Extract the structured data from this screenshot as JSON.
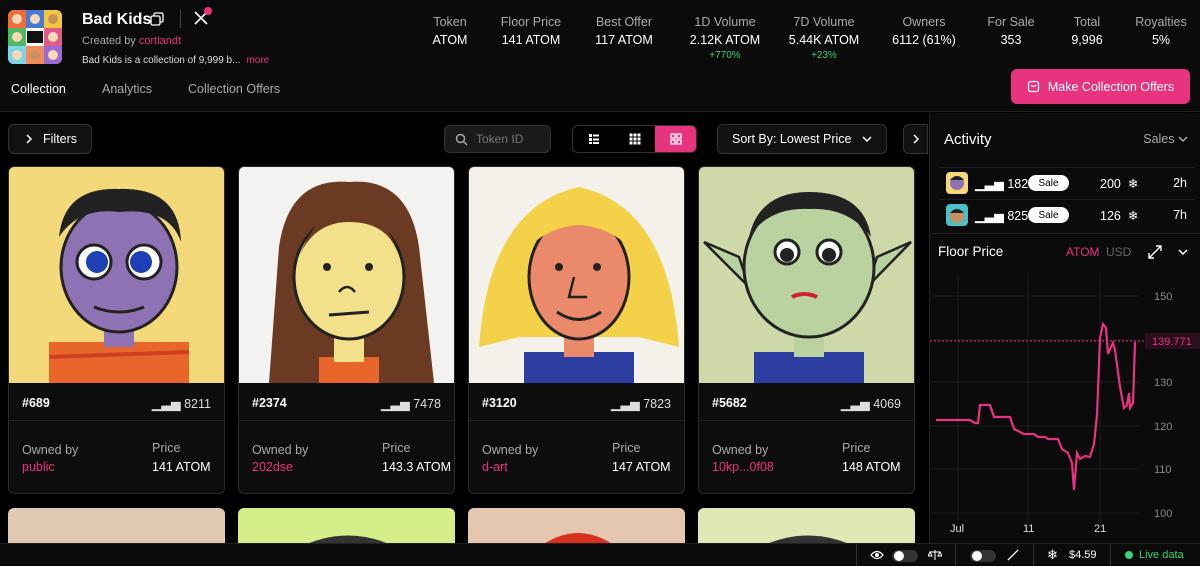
{
  "collection": {
    "name": "Bad Kids",
    "created_by_label": "Created by",
    "creator": "cortlandt",
    "description": "Bad Kids is a collection of 9,999 b...",
    "more_label": "more"
  },
  "stats": [
    {
      "label": "Token",
      "value": "ATOM",
      "change": ""
    },
    {
      "label": "Floor Price",
      "value": "141 ATOM",
      "change": ""
    },
    {
      "label": "Best Offer",
      "value": "117 ATOM",
      "change": ""
    },
    {
      "label": "1D Volume",
      "value": "2.12K ATOM",
      "change": "+770%"
    },
    {
      "label": "7D Volume",
      "value": "5.44K ATOM",
      "change": "+23%"
    },
    {
      "label": "Owners",
      "value": "6112 (61%)",
      "change": ""
    },
    {
      "label": "For Sale",
      "value": "353",
      "change": ""
    },
    {
      "label": "Total",
      "value": "9,996",
      "change": ""
    },
    {
      "label": "Royalties",
      "value": "5%",
      "change": ""
    }
  ],
  "actions": {
    "make_offers": "Make Collection Offers"
  },
  "tabs": [
    "Collection",
    "Analytics",
    "Collection Offers"
  ],
  "toolbar": {
    "filters": "Filters",
    "search_placeholder": "Token ID",
    "sort": "Sort By: Lowest Price"
  },
  "cards": [
    {
      "id": "#689",
      "rank": "8211",
      "owned_label": "Owned by",
      "owner": "public",
      "price_label": "Price",
      "price": "141 ATOM"
    },
    {
      "id": "#2374",
      "rank": "7478",
      "owned_label": "Owned by",
      "owner": "202dse",
      "price_label": "Price",
      "price": "143.3 ATOM"
    },
    {
      "id": "#3120",
      "rank": "7823",
      "owned_label": "Owned by",
      "owner": "d-art",
      "price_label": "Price",
      "price": "147 ATOM"
    },
    {
      "id": "#5682",
      "rank": "4069",
      "owned_label": "Owned by",
      "owner": "10kp...0f08",
      "price_label": "Price",
      "price": "148 ATOM"
    }
  ],
  "activity": {
    "title": "Activity",
    "filter": "Sales",
    "rows": [
      {
        "rank": "182",
        "type": "Sale",
        "amount": "200",
        "time": "2h"
      },
      {
        "rank": "8251",
        "type": "Sale",
        "amount": "126",
        "time": "7h"
      }
    ]
  },
  "floor_chart": {
    "title": "Floor Price",
    "unit_active": "ATOM",
    "unit_inactive": "USD",
    "current_label": "139.771",
    "y_ticks": [
      "150",
      "140",
      "130",
      "120",
      "110",
      "100"
    ],
    "x_ticks": [
      "Jul",
      "11",
      "21"
    ]
  },
  "footer": {
    "price": "$4.59",
    "live": "Live data"
  },
  "colors": {
    "accent": "#e8337e",
    "live": "#38d27a"
  }
}
